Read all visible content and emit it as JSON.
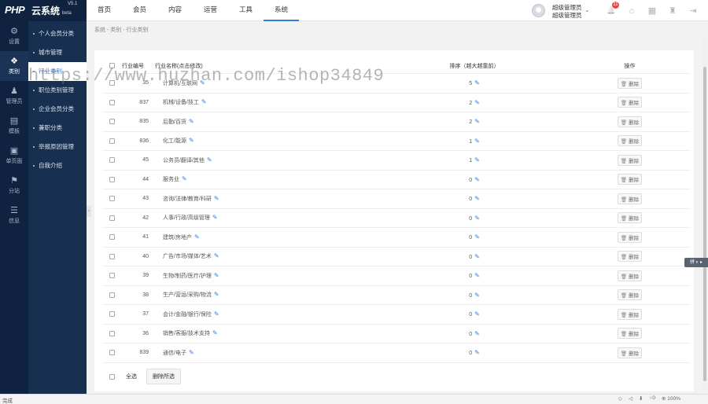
{
  "logo": {
    "brand": "PHP",
    "brand2": "云系统",
    "version": "V5.1",
    "beta": "beta"
  },
  "topnav": [
    "首页",
    "会员",
    "内容",
    "运营",
    "工具",
    "系统"
  ],
  "user": {
    "line1": "超级管理员",
    "line2": "超级管理员",
    "caret": "⌄"
  },
  "notifications": {
    "count": "11"
  },
  "top_icons": {
    "bell": "🔔",
    "home": "⌂",
    "grid": "▦",
    "clear": "♜",
    "logout": "⇥"
  },
  "iconbar": [
    {
      "icon": "gear-icon",
      "glyph": "⚙",
      "label": "设置"
    },
    {
      "icon": "category-icon",
      "glyph": "❖",
      "label": "类别"
    },
    {
      "icon": "manager-icon",
      "glyph": "♟",
      "label": "管理员"
    },
    {
      "icon": "template-icon",
      "glyph": "▤",
      "label": "模板"
    },
    {
      "icon": "page-icon",
      "glyph": "▣",
      "label": "单页面"
    },
    {
      "icon": "site-icon",
      "glyph": "⚑",
      "label": "分站"
    },
    {
      "icon": "info-icon",
      "glyph": "☰",
      "label": "信息"
    }
  ],
  "submenu": [
    "个人会员分类",
    "城市管理",
    "行业类别",
    "职位类别管理",
    "企业会员分类",
    "兼职分类",
    "举报原因管理",
    "自我介绍"
  ],
  "breadcrumb": "系统 - 类别 - 行业类别",
  "table": {
    "headers": {
      "id": "行业编号",
      "name": "行业名称(点击修改)",
      "sort": "排序（越大越靠前）",
      "op": "操作"
    },
    "delete_label": "删除",
    "rows": [
      {
        "id": "35",
        "name": "计算机/互联网",
        "sort": "5"
      },
      {
        "id": "837",
        "name": "机械/设备/技工",
        "sort": "2"
      },
      {
        "id": "835",
        "name": "后勤/百货",
        "sort": "2"
      },
      {
        "id": "836",
        "name": "化工/能源",
        "sort": "1"
      },
      {
        "id": "45",
        "name": "公务员/翻译/其他",
        "sort": "1"
      },
      {
        "id": "44",
        "name": "服务业",
        "sort": "0"
      },
      {
        "id": "43",
        "name": "咨询/法律/教育/科研",
        "sort": "0"
      },
      {
        "id": "42",
        "name": "人事/行政/高级管理",
        "sort": "0"
      },
      {
        "id": "41",
        "name": "建筑/房地产",
        "sort": "0"
      },
      {
        "id": "40",
        "name": "广告/市场/媒体/艺术",
        "sort": "0"
      },
      {
        "id": "39",
        "name": "生物/制药/医疗/护理",
        "sort": "0"
      },
      {
        "id": "38",
        "name": "生产/营运/采购/物流",
        "sort": "0"
      },
      {
        "id": "37",
        "name": "会计/金融/银行/保险",
        "sort": "0"
      },
      {
        "id": "36",
        "name": "销售/客服/技术支持",
        "sort": "0"
      },
      {
        "id": "839",
        "name": "通信/电子",
        "sort": "0"
      }
    ]
  },
  "footer": {
    "select_all": "全选",
    "bulk_delete": "删除所选"
  },
  "float_tool": "拼 ◐ ▸",
  "watermark": "https://www.huzhan.com/ishop34849",
  "status": {
    "left": "完成",
    "zoom": "100%",
    "count": "0"
  }
}
